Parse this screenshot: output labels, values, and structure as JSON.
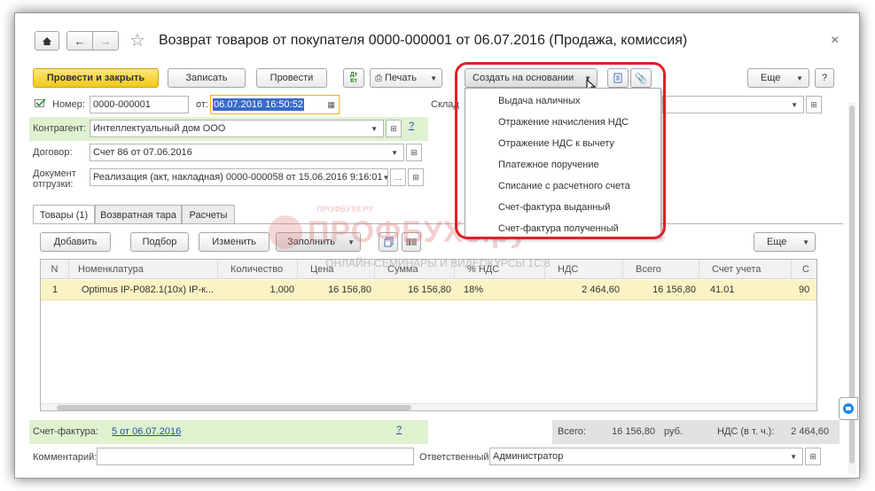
{
  "window": {
    "title": "Возврат товаров от покупателя 0000-000001 от 06.07.2016 (Продажа, комиссия)",
    "close_glyph": "×"
  },
  "toolbar": {
    "post_close_label": "Провести и закрыть",
    "save_label": "Записать",
    "post_label": "Провести",
    "dtkt_label": "Дт Кт",
    "print_label": "Печать",
    "create_based_label": "Создать на основании",
    "more_label": "Еще",
    "help_label": "?"
  },
  "header": {
    "number_label": "Номер:",
    "number_value": "0000-000001",
    "date_label": "от:",
    "date_value": "06.07.2016 16:50:52",
    "warehouse_label": "Склад",
    "counterparty_label": "Контрагент:",
    "counterparty_value": "Интеллектуальный дом ООО",
    "contract_label": "Договор:",
    "contract_value": "Счет 86 от 07.06.2016",
    "shipment_label_1": "Документ",
    "shipment_label_2": "отгрузки:",
    "shipment_value": "Реализация (акт, накладная) 0000-000058 от 15.06.2016 9:16:01",
    "help_q": "?"
  },
  "dropdown_menu": {
    "items": [
      "Выдача наличных",
      "Отражение начисления НДС",
      "Отражение НДС к вычету",
      "Платежное поручение",
      "Списание с расчетного счета",
      "Счет-фактура выданный",
      "Счет-фактура полученный"
    ]
  },
  "tabs": [
    "Товары (1)",
    "Возвратная тара",
    "Расчеты"
  ],
  "table_toolbar": {
    "add_label": "Добавить",
    "select_label": "Подбор",
    "edit_label": "Изменить",
    "fill_label": "Заполнить",
    "more_label": "Еще"
  },
  "table": {
    "columns": [
      "N",
      "Номенклатура",
      "Количество",
      "Цена",
      "Сумма",
      "% НДС",
      "НДС",
      "Всего",
      "Счет учета",
      "С"
    ],
    "rows": [
      [
        "1",
        "Optimus IP-P082.1(10x) IP-к...",
        "1,000",
        "16 156,80",
        "16 156,80",
        "18%",
        "2 464,60",
        "16 156,80",
        "41.01",
        "90"
      ]
    ]
  },
  "footer": {
    "invoice_label": "Счет-фактура:",
    "invoice_link": "5 от 06.07.2016",
    "invoice_help": "?",
    "total_label": "Всего:",
    "total_value": "16 156,80",
    "currency": "руб.",
    "vat_label": "НДС (в т. ч.):",
    "vat_value": "2 464,60",
    "comment_label": "Комментарий:",
    "responsible_label": "Ответственный:",
    "responsible_value": "Администратор"
  },
  "watermark": {
    "brand": "ПРОФБУХ8.ру",
    "tagline": "ОНЛАЙН-СЕМИНАРЫ И ВИДЕОКУРСЫ 1С:8",
    "small": "ПРОФБУХ8.РУ"
  },
  "colors": {
    "accent_yellow": "#f2c81a",
    "highlight_red": "#e0202a",
    "green_panel": "#dff2d0",
    "selected_row": "#fbf3c4"
  }
}
